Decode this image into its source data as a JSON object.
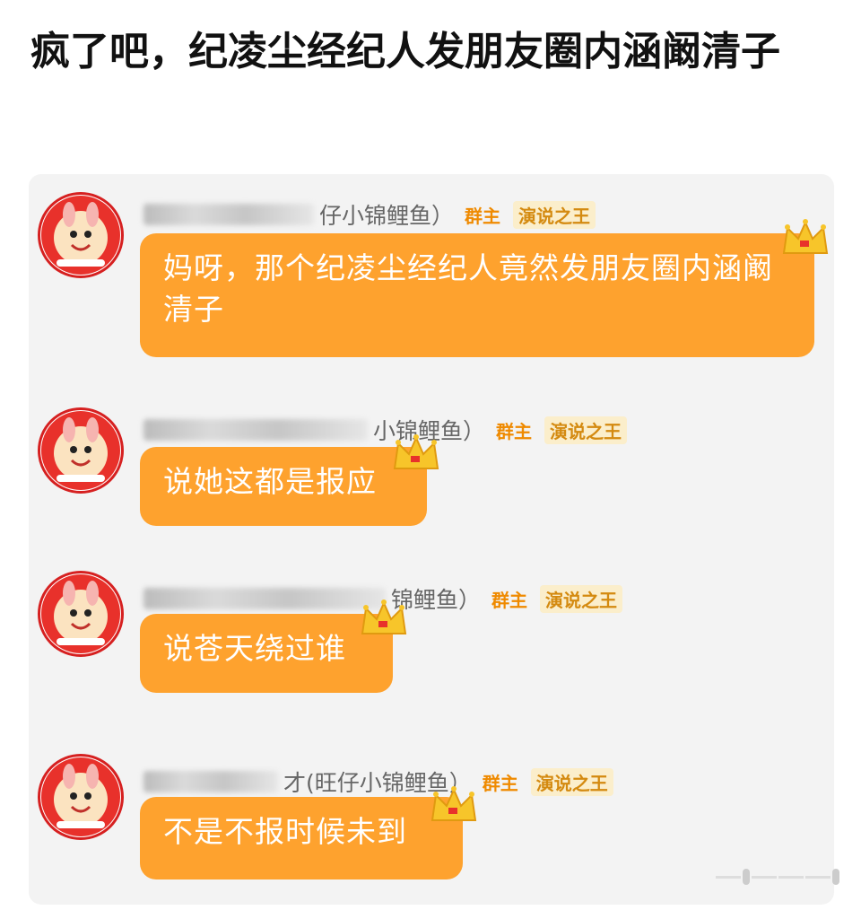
{
  "post": {
    "title": "疯了吧，纪凌尘经纪人发朋友圈内涵阚清子"
  },
  "chat": {
    "messages": [
      {
        "sender": "仔小锦鲤鱼）",
        "role_badge": "群主",
        "title_badge": "演说之王",
        "text": "妈呀，那个纪凌尘经纪人竟然发朋友圈内涵阚清子"
      },
      {
        "sender": "小锦鲤鱼）",
        "role_badge": "群主",
        "title_badge": "演说之王",
        "text": "说她这都是报应"
      },
      {
        "sender": "锦鲤鱼）",
        "role_badge": "群主",
        "title_badge": "演说之王",
        "text": "说苍天绕过谁"
      },
      {
        "sender": "才(旺仔小锦鲤鱼）",
        "role_badge": "群主",
        "title_badge": "演说之王",
        "text": "不是不报时候未到"
      }
    ]
  },
  "colors": {
    "bubble": "#fea22e",
    "badge_owner": "#ef8a00",
    "card_bg": "#f3f3f3"
  },
  "icons": {
    "avatar": "want-want-mascot-avatar",
    "crown": "gold-crown-icon"
  }
}
